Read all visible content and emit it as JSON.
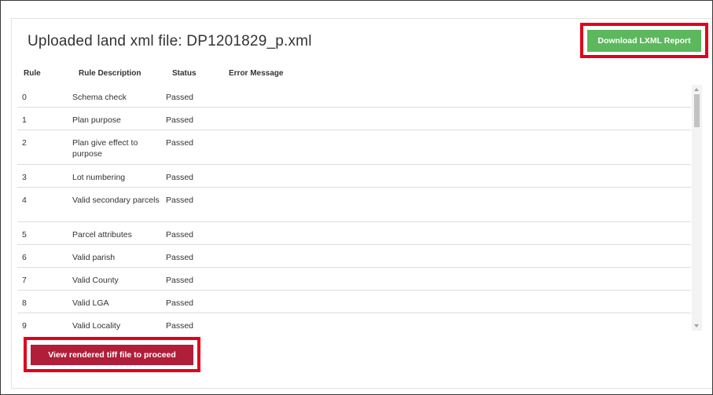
{
  "page": {
    "title": "Uploaded land xml file: DP1201829_p.xml"
  },
  "buttons": {
    "download_label": "Download LXML Report",
    "view_label": "View rendered tiff file to proceed"
  },
  "colors": {
    "download_button": "#5cb85c",
    "view_button": "#b01e3a",
    "highlight_border": "#e0001b"
  },
  "table": {
    "headers": [
      "Rule",
      "Rule Description",
      "Status",
      "Error Message"
    ],
    "rows": [
      {
        "rule": "0",
        "description": "Schema check",
        "status": "Passed",
        "error": ""
      },
      {
        "rule": "1",
        "description": "Plan purpose",
        "status": "Passed",
        "error": ""
      },
      {
        "rule": "2",
        "description": "Plan give effect to purpose",
        "status": "Passed",
        "error": ""
      },
      {
        "rule": "3",
        "description": "Lot numbering",
        "status": "Passed",
        "error": ""
      },
      {
        "rule": "4",
        "description": "Valid secondary parcels",
        "status": "Passed",
        "error": ""
      },
      {
        "rule": "5",
        "description": "Parcel attributes",
        "status": "Passed",
        "error": ""
      },
      {
        "rule": "6",
        "description": "Valid parish",
        "status": "Passed",
        "error": ""
      },
      {
        "rule": "7",
        "description": "Valid County",
        "status": "Passed",
        "error": ""
      },
      {
        "rule": "8",
        "description": "Valid LGA",
        "status": "Passed",
        "error": ""
      },
      {
        "rule": "9",
        "description": "Valid Locality",
        "status": "Passed",
        "error": ""
      }
    ]
  },
  "icons": {
    "scroll_up": "scroll-up-arrow-icon",
    "scroll_down": "scroll-down-arrow-icon"
  }
}
